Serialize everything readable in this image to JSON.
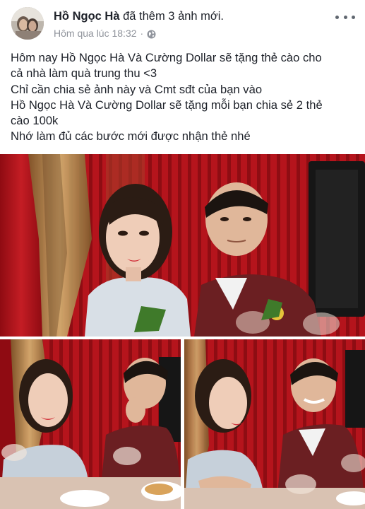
{
  "post": {
    "author_name": "Hồ Ngọc Hà",
    "action_text": " đã thêm 3 ảnh mới.",
    "timestamp": "Hôm qua lúc 18:32",
    "separator": "·",
    "privacy_icon": "globe-icon",
    "more_icon": "more-options-icon",
    "body_lines": [
      "Hôm nay Hồ Ngọc Hà Và Cường Dollar sẽ tặng thẻ cào cho",
      "cả nhà làm quà trung thu <3",
      "Chỉ cần chia sẻ ảnh này và Cmt sđt của bạn vào",
      "Hồ Ngọc Hà Và Cường Dollar sẽ tặng mỗi bạn chia sẻ 2 thẻ",
      "cào 100k",
      "Nhớ làm đủ các bước mới được nhận thẻ nhé"
    ],
    "photo_count": 3
  },
  "colors": {
    "text": "#1d2129",
    "meta": "#90949c",
    "curtain_red": "#b0131c",
    "curtain_gold": "#b8944e"
  }
}
